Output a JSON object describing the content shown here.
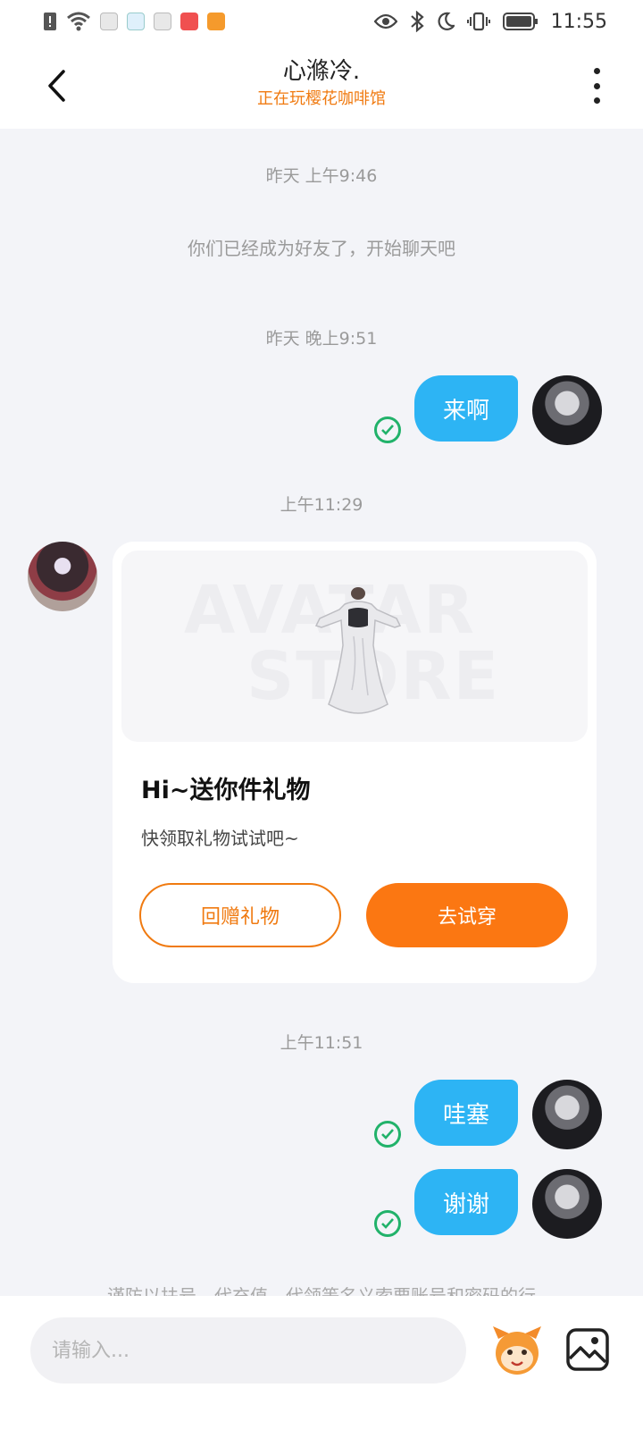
{
  "status_bar": {
    "time": "11:55",
    "icons": [
      "alert-icon",
      "wifi-icon",
      "app-icon",
      "app-icon",
      "app-icon",
      "app-icon",
      "video-app-icon",
      "eye-icon",
      "bluetooth-icon",
      "moon-icon",
      "vibrate-icon",
      "battery-icon"
    ]
  },
  "header": {
    "title": "心滌冷.",
    "subtitle": "正在玩樱花咖啡馆",
    "back_icon": "chevron-left-icon",
    "more_icon": "more-vertical-icon"
  },
  "messages": {
    "ts1": "昨天 上午9:46",
    "system_text": "你们已经成为好友了，开始聊天吧",
    "ts2": "昨天 晚上9:51",
    "msg1": "来啊",
    "ts3": "上午11:29",
    "ts4": "上午11:51",
    "msg2": "哇塞",
    "msg3": "谢谢"
  },
  "gift_card": {
    "watermark_line1": "AVATAR",
    "watermark_line2": "STORE",
    "title": "Hi~送你件礼物",
    "description": "快领取礼物试试吧~",
    "return_button": "回赠礼物",
    "try_button": "去试穿"
  },
  "notice": "谨防以扶号、代充值、代领等名义索要账号和密码的行",
  "input": {
    "placeholder": "请输入..."
  },
  "colors": {
    "bubble": "#2db4f4",
    "accent_orange": "#fb7712",
    "check_green": "#21b26a",
    "background": "#f3f4f8"
  }
}
